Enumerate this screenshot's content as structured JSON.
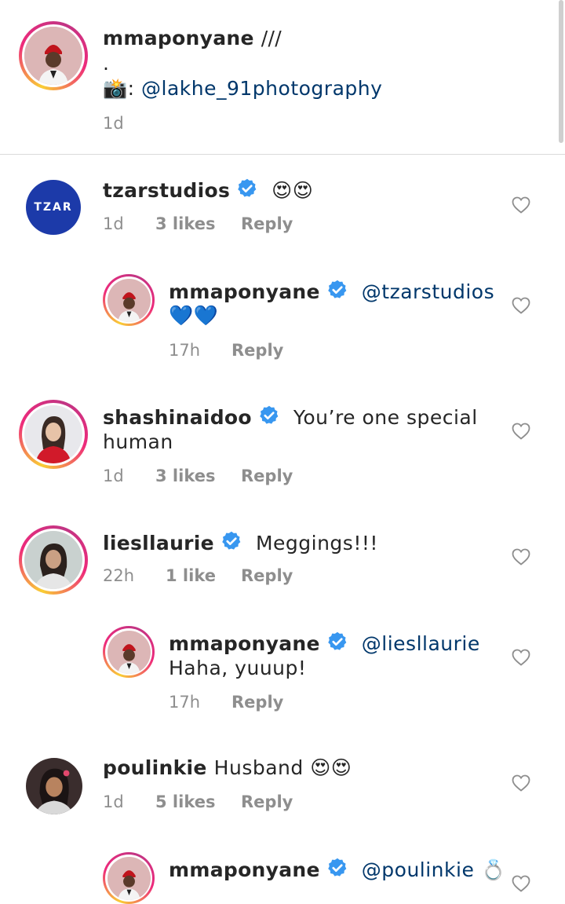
{
  "post": {
    "username": "mmaponyane",
    "caption_suffix": "///",
    "caption_dot": ".",
    "camera_emoji": "📸",
    "colon": ":",
    "mention": "@lakhe_91photography",
    "time": "1d"
  },
  "comments": [
    {
      "username": "tzarstudios",
      "verified": true,
      "text": "😍😍",
      "time": "1d",
      "likes": "3 likes",
      "reply": "Reply",
      "avatar_text": "TZAR",
      "replies": [
        {
          "username": "mmaponyane",
          "verified": true,
          "mention": "@tzarstudios",
          "text": "💙💙",
          "time": "17h",
          "reply": "Reply"
        }
      ]
    },
    {
      "username": "shashinaidoo",
      "verified": true,
      "text_line1": "You’re one special",
      "text_line2": "human",
      "time": "1d",
      "likes": "3 likes",
      "reply": "Reply"
    },
    {
      "username": "liesllaurie",
      "verified": true,
      "text": "Meggings!!!",
      "time": "22h",
      "likes": "1 like",
      "reply": "Reply",
      "replies": [
        {
          "username": "mmaponyane",
          "verified": true,
          "mention": "@liesllaurie",
          "text": "Haha, yuuup!",
          "time": "17h",
          "reply": "Reply"
        }
      ]
    },
    {
      "username": "poulinkie",
      "verified": false,
      "text": "Husband 😍😍",
      "time": "1d",
      "likes": "5 likes",
      "reply": "Reply",
      "replies": [
        {
          "username": "mmaponyane",
          "verified": true,
          "mention": "@poulinkie",
          "text": "💍"
        }
      ]
    }
  ],
  "colors": {
    "text": "#262626",
    "meta": "#8e8e8e",
    "mention": "#00376b",
    "verified": "#3897f0",
    "tzar_bg": "#1c3aa9"
  }
}
